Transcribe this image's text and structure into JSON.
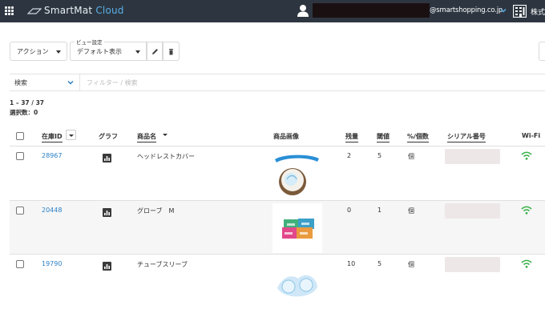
{
  "header": {
    "logo_text_main": "SmartMat ",
    "logo_text_accent": "Cloud",
    "user_email": "@smartshopping.co.jp",
    "company_name": "株式"
  },
  "toolbar": {
    "action_label": "アクション",
    "view_setting_label": "ビュー設定",
    "view_selected": "デフォルト表示"
  },
  "search": {
    "field_selected": "検索",
    "placeholder": "フィルター / 検索"
  },
  "summary": {
    "range": "1 – 37 / 37",
    "selected": "選択数：0"
  },
  "table": {
    "columns": {
      "stock_id": "在庫ID",
      "graph": "グラフ",
      "product_name": "商品名",
      "product_image": "商品画像",
      "remaining": "残量",
      "threshold": "閾値",
      "unit": "%/個数",
      "serial": "シリアル番号",
      "wifi": "Wi-Fi"
    },
    "rows": [
      {
        "stock_id": "28967",
        "product_name": "ヘッドレストカバー",
        "remaining": "2",
        "threshold": "5",
        "unit": "個"
      },
      {
        "stock_id": "20448",
        "product_name": "グローブ　M",
        "remaining": "0",
        "threshold": "1",
        "unit": "個"
      },
      {
        "stock_id": "19790",
        "product_name": "チューブスリーブ",
        "remaining": "10",
        "threshold": "5",
        "unit": "個"
      }
    ]
  },
  "colors": {
    "topbar": "#2d3640",
    "link": "#2a7fc5",
    "wifi": "#3cb24a",
    "accent": "#5aaee8"
  },
  "icons": [
    "apps-grid-icon",
    "user-icon",
    "chevron-down-icon",
    "company-building-icon",
    "edit-icon",
    "trash-icon",
    "bar-chart-icon",
    "wifi-icon"
  ]
}
